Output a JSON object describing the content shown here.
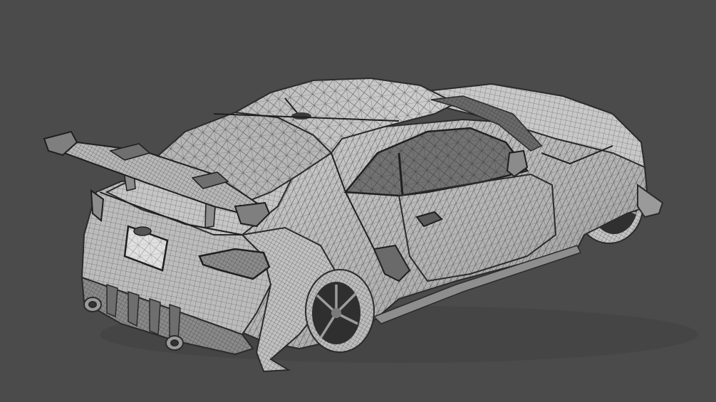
{
  "viewport": {
    "background_color": "#4b4b4b",
    "object": "car-wireframe-model",
    "shading_mode": "wireframe-on-shaded",
    "colors": {
      "surface_light": "#c9c9c9",
      "surface_mid": "#a9a9a9",
      "surface_dark": "#7b7b7b",
      "glass": "#5d5d5d",
      "tire": "#2a2a2a",
      "wire": "#2b2b2b"
    }
  }
}
